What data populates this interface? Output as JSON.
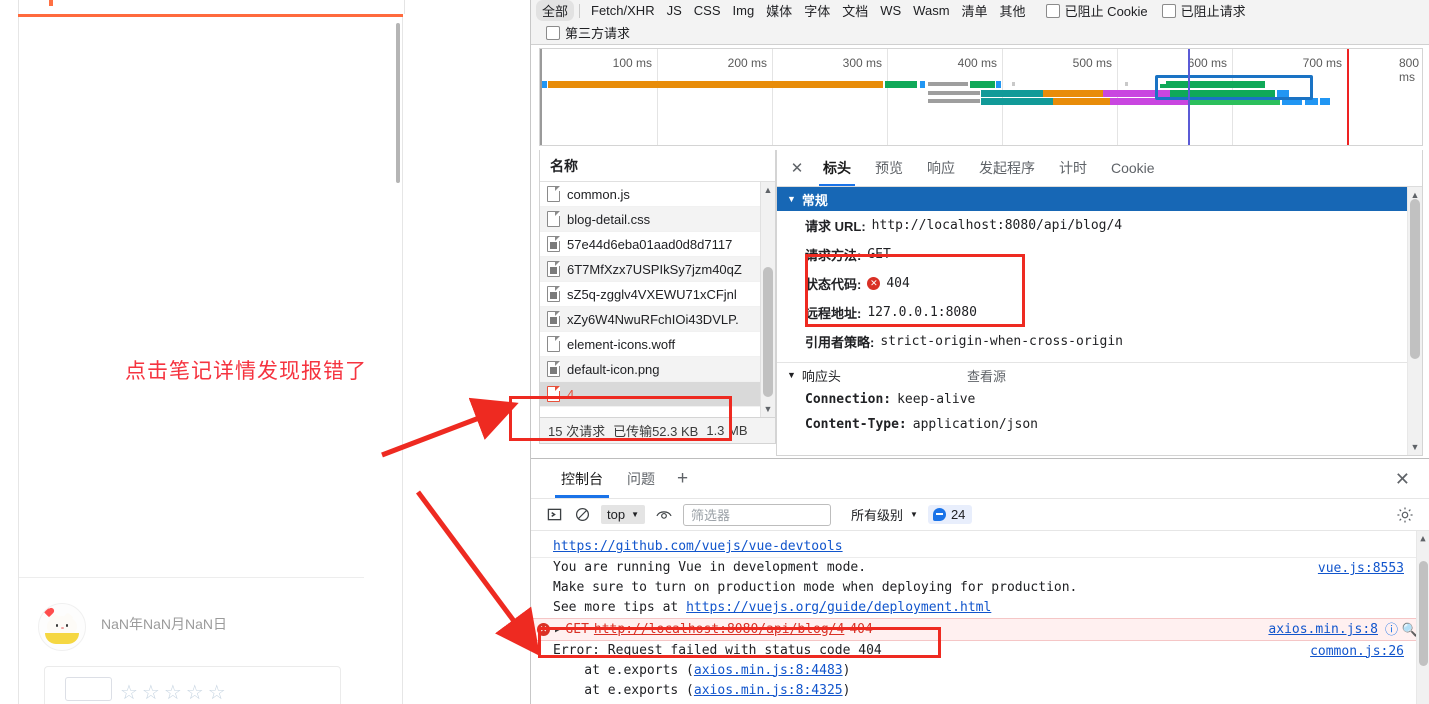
{
  "page": {
    "annotation": "点击笔记详情发现报错了",
    "comment_date": "NaN年NaN月NaN日",
    "stars": "☆☆☆☆☆"
  },
  "devtools": {
    "network": {
      "filters": [
        {
          "label": "全部",
          "active": true
        },
        {
          "label": "Fetch/XHR",
          "active": false
        },
        {
          "label": "JS",
          "active": false
        },
        {
          "label": "CSS",
          "active": false
        },
        {
          "label": "Img",
          "active": false
        },
        {
          "label": "媒体",
          "active": false
        },
        {
          "label": "字体",
          "active": false
        },
        {
          "label": "文档",
          "active": false
        },
        {
          "label": "WS",
          "active": false
        },
        {
          "label": "Wasm",
          "active": false
        },
        {
          "label": "清单",
          "active": false
        },
        {
          "label": "其他",
          "active": false
        }
      ],
      "checkboxes": [
        {
          "label": "已阻止 Cookie",
          "checked": false
        },
        {
          "label": "已阻止请求",
          "checked": false
        }
      ],
      "third_party_label": "第三方请求",
      "timeline_ticks": [
        "100 ms",
        "200 ms",
        "300 ms",
        "400 ms",
        "500 ms",
        "600 ms",
        "700 ms",
        "800 ms"
      ],
      "list_header": "名称",
      "requests": [
        {
          "name": "common.js",
          "type": "file",
          "selected": false
        },
        {
          "name": "blog-detail.css",
          "type": "file",
          "selected": false
        },
        {
          "name": "57e44d6eba01aad0d8d7117",
          "type": "image",
          "selected": false
        },
        {
          "name": "6T7MfXzx7USPIkSy7jzm40qZ",
          "type": "image",
          "selected": false
        },
        {
          "name": "sZ5q-zgglv4VXEWU71xCFjnl",
          "type": "image",
          "selected": false
        },
        {
          "name": "xZy6W4NwuRFchIOi43DVLP.",
          "type": "image",
          "selected": false
        },
        {
          "name": "element-icons.woff",
          "type": "file",
          "selected": false
        },
        {
          "name": "default-icon.png",
          "type": "image",
          "selected": false
        },
        {
          "name": "4",
          "type": "error",
          "selected": true
        }
      ],
      "status_requests": "15 次请求",
      "status_transferred": "已传输52.3 KB",
      "status_resources": "1.3 MB"
    },
    "detail": {
      "tabs": [
        {
          "label": "标头",
          "active": true
        },
        {
          "label": "预览",
          "active": false
        },
        {
          "label": "响应",
          "active": false
        },
        {
          "label": "发起程序",
          "active": false
        },
        {
          "label": "计时",
          "active": false
        },
        {
          "label": "Cookie",
          "active": false
        }
      ],
      "general_section": "常规",
      "general": [
        {
          "key": "请求 URL:",
          "value": "http://localhost:8080/api/blog/4"
        },
        {
          "key": "请求方法:",
          "value": "GET"
        },
        {
          "key": "状态代码:",
          "value": "404",
          "error": true
        },
        {
          "key": "远程地址:",
          "value": "127.0.0.1:8080"
        },
        {
          "key": "引用者策略:",
          "value": "strict-origin-when-cross-origin"
        }
      ],
      "response_section": "响应头",
      "view_source": "查看源",
      "response_headers": [
        {
          "key": "Connection:",
          "value": "keep-alive"
        },
        {
          "key": "Content-Type:",
          "value": "application/json"
        }
      ]
    },
    "drawer": {
      "tabs": [
        {
          "label": "控制台",
          "active": true
        },
        {
          "label": "问题",
          "active": false
        }
      ],
      "add_label": "+",
      "close_label": "✕",
      "context": "top",
      "filter_placeholder": "筛选器",
      "level": "所有级别",
      "message_count": "24",
      "log": [
        {
          "type": "link-only",
          "text": "https://github.com/vuejs/vue-devtools"
        },
        {
          "type": "info",
          "lines": [
            "You are running Vue in development mode.",
            "Make sure to turn on production mode when deploying for production.",
            "See more tips at "
          ],
          "inline_link": "https://vuejs.org/guide/deployment.html",
          "source": "vue.js:8553"
        },
        {
          "type": "error",
          "method": "GET",
          "url": "http://localhost:8080/api/blog/4",
          "status": "404",
          "source": "axios.min.js:8"
        },
        {
          "type": "trace",
          "lines": [
            "Error: Request failed with status code 404",
            "    at e.exports (axios.min.js:8:4483)",
            "    at e.exports (axios.min.js:8:4325)"
          ],
          "source": "common.js:26",
          "link1": "axios.min.js:8:4483",
          "link2": "axios.min.js:8:4325"
        }
      ]
    }
  }
}
